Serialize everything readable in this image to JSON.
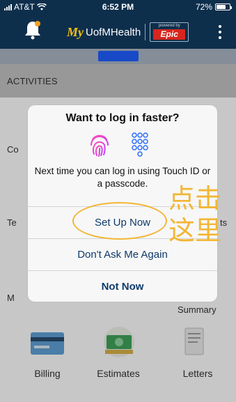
{
  "status_bar": {
    "carrier": "AT&T",
    "time": "6:52 PM",
    "battery_text": "72%",
    "battery_level": 0.72
  },
  "header": {
    "brand_my": "My",
    "brand_name": "UofMHealth",
    "powered_by": "powered by",
    "epic": "Epic",
    "icons": [
      "bell-icon",
      "more-vertical-icon"
    ]
  },
  "background": {
    "section_title": "ACTIVITIES",
    "partial_labels": [
      "Co",
      "Te",
      "ts",
      "M"
    ],
    "summary_label": "Summary",
    "tiles": [
      {
        "label": "Billing",
        "icon": "credit-card-icon"
      },
      {
        "label": "Estimates",
        "icon": "cash-icon"
      },
      {
        "label": "Letters",
        "icon": "document-icon"
      }
    ]
  },
  "dialog": {
    "title": "Want to log in faster?",
    "message": "Next time you can log in using Touch ID or a passcode.",
    "icons": [
      "fingerprint-icon",
      "passcode-keypad-icon"
    ],
    "buttons": {
      "setup": "Set Up Now",
      "dont_ask": "Don't Ask Me Again",
      "not_now": "Not Now"
    }
  },
  "annotation": {
    "line1": "点击",
    "line2": "这里",
    "color": "#f2b635"
  },
  "colors": {
    "header_bg": "#0e2f4c",
    "dialog_button_text": "#0f3a6a",
    "fingerprint_gradient": [
      "#ff4fb2",
      "#c13cff"
    ],
    "passcode_blue": "#2a6cff"
  }
}
